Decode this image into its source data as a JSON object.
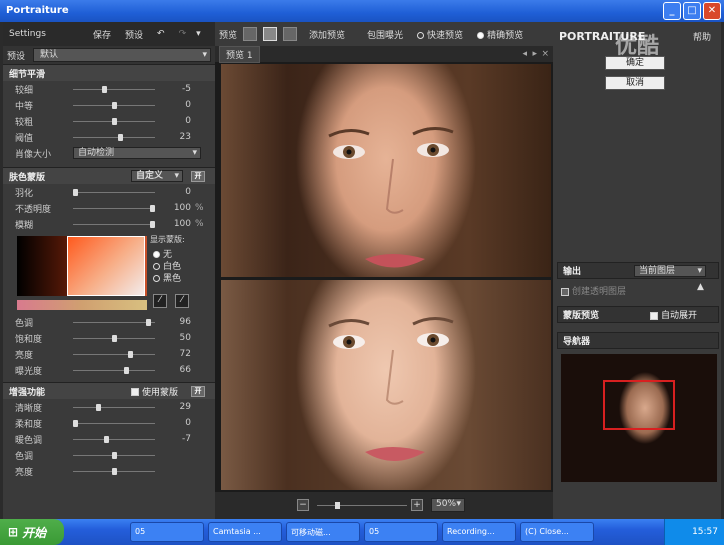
{
  "window": {
    "title": "Portraiture"
  },
  "left": {
    "header": {
      "title": "Settings",
      "save": "保存",
      "preset": "预设"
    },
    "preset": {
      "label": "预设",
      "value": "默认"
    },
    "detail": {
      "title": "细节平滑",
      "rows": [
        {
          "label": "较细",
          "value": "-5",
          "pos": 0.38
        },
        {
          "label": "中等",
          "value": "0",
          "pos": 0.5
        },
        {
          "label": "较粗",
          "value": "0",
          "pos": 0.5
        },
        {
          "label": "阈值",
          "value": "23",
          "pos": 0.58
        }
      ],
      "portrait_size_label": "肖像大小",
      "portrait_size_value": "自动检测"
    },
    "mask": {
      "title": "肤色蒙版",
      "mode": "自定义",
      "btn": "开",
      "rows": [
        {
          "label": "羽化",
          "value": "0",
          "unit": "",
          "pos": 0.0
        },
        {
          "label": "不透明度",
          "value": "100",
          "unit": "%",
          "pos": 1.0
        },
        {
          "label": "模糊",
          "value": "100",
          "unit": "%",
          "pos": 1.0
        }
      ],
      "show_mask_label": "显示蒙版:",
      "opt_none": "无",
      "opt_white": "白色",
      "opt_black": "黑色",
      "color_rows": [
        {
          "label": "色调",
          "value": "96",
          "unit": "",
          "pos": 0.95
        },
        {
          "label": "饱和度",
          "value": "50",
          "unit": "",
          "pos": 0.5
        },
        {
          "label": "亮度",
          "value": "72",
          "unit": "",
          "pos": 0.72
        },
        {
          "label": "曝光度",
          "value": "66",
          "unit": "",
          "pos": 0.66
        }
      ]
    },
    "enhance": {
      "title": "增强功能",
      "use_mask": "使用蒙版",
      "btn": "开",
      "rows": [
        {
          "label": "清晰度",
          "value": "29",
          "pos": 0.3
        },
        {
          "label": "柔和度",
          "value": "0",
          "pos": 0.0
        },
        {
          "label": "暖色调",
          "value": "-7",
          "pos": 0.4
        },
        {
          "label": "色调",
          "value": "",
          "pos": 0.5
        },
        {
          "label": "亮度",
          "value": "",
          "pos": 0.5
        }
      ]
    }
  },
  "mid": {
    "toolbar": {
      "preview": "预览",
      "add_preview": "添加预览",
      "bracket": "包围曝光",
      "fast": "快速预览",
      "precise": "精确预览"
    },
    "tab": "预览 1",
    "zoom": "50%"
  },
  "right": {
    "title": "PORTRAITURE",
    "help": "帮助",
    "ok": "确定",
    "cancel": "取消",
    "output_label": "输出",
    "output_value": "当前图层",
    "new_layer": "创建透明图层",
    "mask_preview": "蒙版预览",
    "auto_expand": "自动展开",
    "navigator": "导航器",
    "watermark": "优酷"
  },
  "taskbar": {
    "start": "开始",
    "tasks": [
      "05",
      "Camtasia ...",
      "可移动磁...",
      "05",
      "Recording...",
      "(C) Close..."
    ],
    "time": "15:57"
  }
}
